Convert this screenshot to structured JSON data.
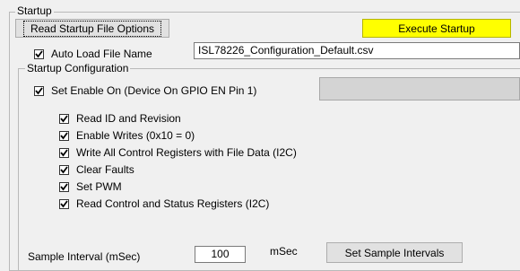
{
  "startup": {
    "group_label": "Startup",
    "read_button": "Read Startup File Options",
    "execute_button": "Execute Startup",
    "execute_color": "#ffff00",
    "auto_load": {
      "label": "Auto Load File Name",
      "checked": true
    },
    "file_name": "ISL78226_Configuration_Default.csv"
  },
  "config": {
    "group_label": "Startup Configuration",
    "set_enable": {
      "label": "Set Enable On (Device On GPIO  EN Pin 1)",
      "checked": true
    },
    "options": [
      {
        "label": "Read ID and Revision",
        "checked": true
      },
      {
        "label": "Enable Writes (0x10 = 0)",
        "checked": true
      },
      {
        "label": "Write All Control Registers with File Data (I2C)",
        "checked": true
      },
      {
        "label": "Clear Faults",
        "checked": true
      },
      {
        "label": "Set PWM",
        "checked": true
      },
      {
        "label": "Read Control and Status Registers (I2C)",
        "checked": true
      }
    ],
    "sample_interval_label": "Sample Interval (mSec)",
    "sample_interval_value": "100",
    "unit_label": "mSec",
    "set_sample_button": "Set Sample Intervals"
  }
}
